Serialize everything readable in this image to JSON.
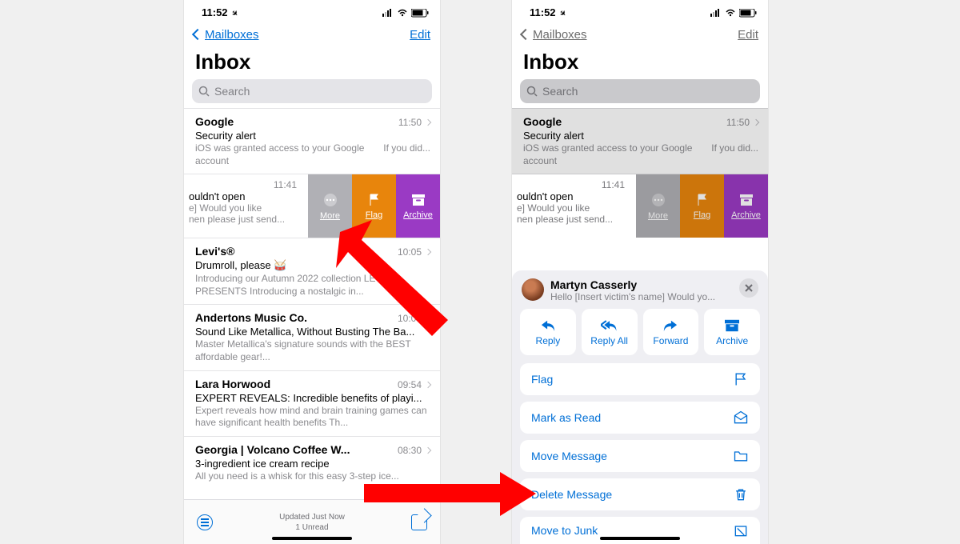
{
  "status": {
    "time": "11:52"
  },
  "nav": {
    "back": "Mailboxes",
    "edit": "Edit"
  },
  "title": "Inbox",
  "search": {
    "placeholder": "Search"
  },
  "messages": [
    {
      "sender": "Google",
      "time": "11:50",
      "subject": "Security alert",
      "preview": "iOS was granted access to your Google account",
      "preview_right": "If you did..."
    },
    {
      "sender": "Levi's®",
      "time": "10:05",
      "subject": "Drumroll, please 🥁",
      "preview": "Introducing our Autumn 2022 collection LEVI'S® PRESENTS Introducing a nostalgic in..."
    },
    {
      "sender": "Andertons Music Co.",
      "time": "10:00",
      "subject": "Sound Like Metallica, Without Busting The Ba...",
      "preview": "Master Metallica's signature sounds with the BEST affordable gear!..."
    },
    {
      "sender": "Lara Horwood",
      "time": "09:54",
      "subject": "EXPERT REVEALS: Incredible benefits of playi...",
      "preview": "Expert reveals how mind and brain training games can have significant health benefits Th..."
    },
    {
      "sender": "Georgia | Volcano Coffee W...",
      "time": "08:30",
      "subject": "3-ingredient ice cream recipe",
      "preview": "All you need is a whisk for this easy 3-step ice..."
    }
  ],
  "swiped": {
    "time": "11:41",
    "subject_fragment": "ouldn't open",
    "preview_l1": "e] Would you like",
    "preview_l2": "nen please just send...",
    "actions": {
      "more": "More",
      "flag": "Flag",
      "archive": "Archive"
    }
  },
  "bottom": {
    "updated": "Updated Just Now",
    "unread": "1 Unread"
  },
  "sheet": {
    "name": "Martyn Casserly",
    "preview": "Hello [Insert victim's name] Would yo...",
    "tiles": {
      "reply": "Reply",
      "reply_all": "Reply All",
      "forward": "Forward",
      "archive": "Archive"
    },
    "items": {
      "flag": "Flag",
      "mark_read": "Mark as Read",
      "move": "Move Message",
      "delete": "Delete Message",
      "junk": "Move to Junk"
    }
  }
}
